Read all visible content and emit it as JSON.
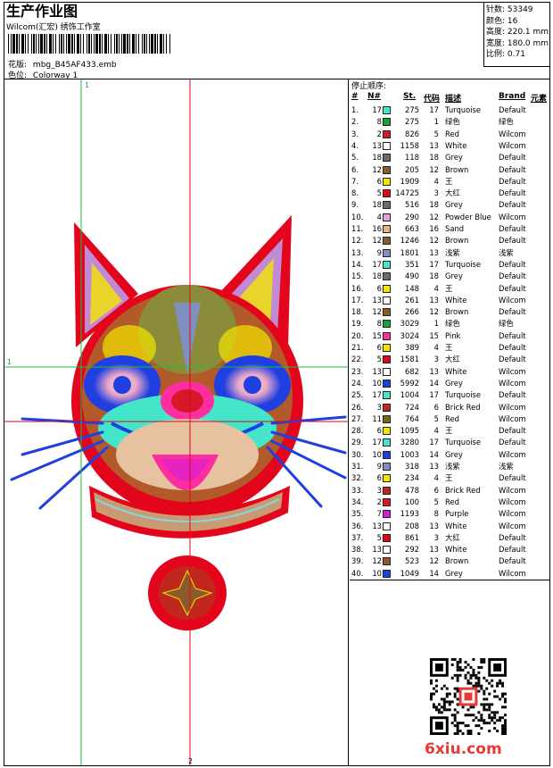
{
  "header": {
    "title": "生产作业图",
    "company": "Wilcom(汇宏) 绣饰工作室",
    "design_label": "花版:",
    "design_file": "mbg_B45AF433.emb",
    "colorway_label": "色位:",
    "colorway": "Colorway 1"
  },
  "stats": {
    "stitches": "针数: 53349",
    "colors": "颜色: 16",
    "height": "高度: 220.1 mm",
    "width": "宽度: 180.0 mm",
    "scale": "比例: 0.71"
  },
  "canvas": {
    "guide_v_top": "1",
    "guide_h_left": "1",
    "guide_v_bottom": "2"
  },
  "stop_sequence": {
    "title": "停止顺序:",
    "headers": [
      "#",
      "N#",
      "St.",
      "代码",
      "描述",
      "Brand",
      "元素"
    ],
    "rows": [
      [
        "1.",
        "17",
        "275",
        "17",
        "Turquoise",
        "Default",
        "#43e6c9"
      ],
      [
        "2.",
        "8",
        "275",
        "1",
        "绿色",
        "绿色",
        "#19a23a"
      ],
      [
        "3.",
        "2",
        "826",
        "5",
        "Red",
        "Wilcom",
        "#d6182a"
      ],
      [
        "4.",
        "13",
        "1158",
        "13",
        "White",
        "Wilcom",
        "#ffffff"
      ],
      [
        "5.",
        "18",
        "118",
        "18",
        "Grey",
        "Default",
        "#6b6b6b"
      ],
      [
        "6.",
        "12",
        "205",
        "12",
        "Brown",
        "Default",
        "#8b5a2b"
      ],
      [
        "7.",
        "6",
        "1909",
        "4",
        "王",
        "Default",
        "#f2e600"
      ],
      [
        "8.",
        "5",
        "14725",
        "3",
        "大红",
        "Default",
        "#e3051b"
      ],
      [
        "9.",
        "18",
        "516",
        "18",
        "Grey",
        "Default",
        "#6b6b6b"
      ],
      [
        "10.",
        "4",
        "290",
        "12",
        "Powder Blue",
        "Wilcom",
        "#e7a2d0"
      ],
      [
        "11.",
        "16",
        "663",
        "16",
        "Sand",
        "Default",
        "#e8b083"
      ],
      [
        "12.",
        "12",
        "1246",
        "12",
        "Brown",
        "Default",
        "#8b5a2b"
      ],
      [
        "13.",
        "9",
        "1801",
        "13",
        "浅紫",
        "浅紫",
        "#7f8fc0"
      ],
      [
        "14.",
        "17",
        "351",
        "17",
        "Turquoise",
        "Default",
        "#43e6c9"
      ],
      [
        "15.",
        "18",
        "490",
        "18",
        "Grey",
        "Default",
        "#6b6b6b"
      ],
      [
        "16.",
        "6",
        "148",
        "4",
        "王",
        "Default",
        "#f2e600"
      ],
      [
        "17.",
        "13",
        "261",
        "13",
        "White",
        "Wilcom",
        "#ffffff"
      ],
      [
        "18.",
        "12",
        "266",
        "12",
        "Brown",
        "Default",
        "#8b5a2b"
      ],
      [
        "19.",
        "8",
        "3029",
        "1",
        "绿色",
        "绿色",
        "#19a23a"
      ],
      [
        "20.",
        "15",
        "3024",
        "15",
        "Pink",
        "Default",
        "#ff2ea0"
      ],
      [
        "21.",
        "6",
        "389",
        "4",
        "王",
        "Default",
        "#f2e600"
      ],
      [
        "22.",
        "5",
        "1581",
        "3",
        "大红",
        "Default",
        "#e3051b"
      ],
      [
        "23.",
        "13",
        "682",
        "13",
        "White",
        "Wilcom",
        "#ffffff"
      ],
      [
        "24.",
        "10",
        "5992",
        "14",
        "Grey",
        "Wilcom",
        "#1f3fe0"
      ],
      [
        "25.",
        "17",
        "1004",
        "17",
        "Turquoise",
        "Default",
        "#43e6c9"
      ],
      [
        "26.",
        "3",
        "724",
        "6",
        "Brick Red",
        "Wilcom",
        "#c0281e"
      ],
      [
        "27.",
        "11",
        "764",
        "5",
        "Red",
        "Wilcom",
        "#7f6a10"
      ],
      [
        "28.",
        "6",
        "1095",
        "4",
        "王",
        "Default",
        "#f2e600"
      ],
      [
        "29.",
        "17",
        "3280",
        "17",
        "Turquoise",
        "Default",
        "#43e6c9"
      ],
      [
        "30.",
        "10",
        "1003",
        "14",
        "Grey",
        "Wilcom",
        "#1f3fe0"
      ],
      [
        "31.",
        "9",
        "318",
        "13",
        "浅紫",
        "浅紫",
        "#7f8fc0"
      ],
      [
        "32.",
        "6",
        "234",
        "4",
        "王",
        "Default",
        "#f2e600"
      ],
      [
        "33.",
        "3",
        "478",
        "6",
        "Brick Red",
        "Wilcom",
        "#c0281e"
      ],
      [
        "34.",
        "2",
        "100",
        "5",
        "Red",
        "Wilcom",
        "#d6182a"
      ],
      [
        "35.",
        "7",
        "1193",
        "8",
        "Purple",
        "Wilcom",
        "#d61ad6"
      ],
      [
        "36.",
        "13",
        "208",
        "13",
        "White",
        "Wilcom",
        "#ffffff"
      ],
      [
        "37.",
        "5",
        "861",
        "3",
        "大红",
        "Default",
        "#e3051b"
      ],
      [
        "38.",
        "13",
        "292",
        "13",
        "White",
        "Default",
        "#ffffff"
      ],
      [
        "39.",
        "12",
        "523",
        "12",
        "Brown",
        "Default",
        "#8b5a2b"
      ],
      [
        "40.",
        "10",
        "1049",
        "14",
        "Grey",
        "Wilcom",
        "#1f3fe0"
      ]
    ]
  },
  "footer": {
    "logo": "6xiu.com"
  }
}
